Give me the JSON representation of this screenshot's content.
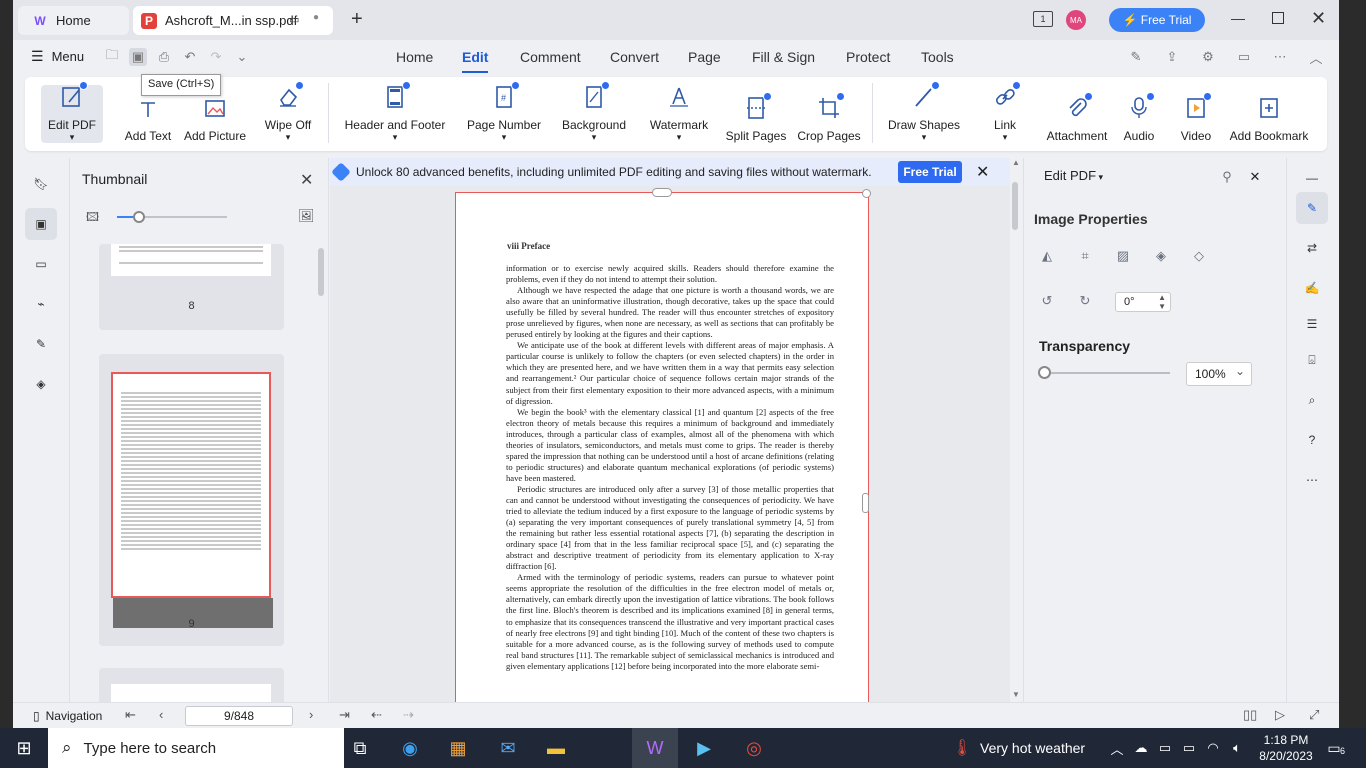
{
  "window": {
    "tabs": [
      {
        "label": "Home"
      },
      {
        "label": "Ashcroft_M...in ssp.pdf"
      }
    ],
    "free_trial": "Free Trial",
    "avatar_initials": "MA"
  },
  "menu": {
    "menu_label": "Menu",
    "tooltip": "Save (Ctrl+S)",
    "tabs": [
      "Home",
      "Edit",
      "Comment",
      "Convert",
      "Page",
      "Fill & Sign",
      "Protect",
      "Tools"
    ],
    "active_tab": "Edit"
  },
  "ribbon": {
    "tools": [
      {
        "label": "Edit PDF",
        "icon": "edit-pdf-icon"
      },
      {
        "label": "Add Text",
        "icon": "add-text-icon"
      },
      {
        "label": "Add Picture",
        "icon": "add-picture-icon"
      },
      {
        "label": "Wipe Off",
        "icon": "eraser-icon"
      },
      {
        "label": "Header and Footer",
        "icon": "header-footer-icon"
      },
      {
        "label": "Page Number",
        "icon": "page-number-icon"
      },
      {
        "label": "Background",
        "icon": "background-icon"
      },
      {
        "label": "Watermark",
        "icon": "watermark-icon"
      },
      {
        "label": "Split Pages",
        "icon": "split-pages-icon"
      },
      {
        "label": "Crop Pages",
        "icon": "crop-pages-icon"
      },
      {
        "label": "Draw Shapes",
        "icon": "draw-shapes-icon"
      },
      {
        "label": "Link",
        "icon": "link-icon"
      },
      {
        "label": "Attachment",
        "icon": "attachment-icon"
      },
      {
        "label": "Audio",
        "icon": "audio-icon"
      },
      {
        "label": "Video",
        "icon": "video-icon"
      },
      {
        "label": "Add Bookmark",
        "icon": "add-bookmark-icon"
      }
    ]
  },
  "thumbnail": {
    "title": "Thumbnail",
    "pages": [
      "8",
      "9"
    ]
  },
  "banner": {
    "text": "Unlock 80 advanced benefits, including unlimited PDF editing and saving files without watermark.",
    "button": "Free Trial"
  },
  "document": {
    "header": "viii   Preface",
    "paragraphs": [
      "information or to exercise newly acquired skills. Readers should therefore examine the problems, even if they do not intend to attempt their solution.",
      "Although we have respected the adage that one picture is worth a thousand words, we are also aware that an uninformative illustration, though decorative, takes up the space that could usefully be filled by several hundred. The reader will thus encounter stretches of expository prose unrelieved by figures, when none are necessary, as well as sections that can profitably be perused entirely by looking at the figures and their captions.",
      "We anticipate use of the book at different levels with different areas of major emphasis. A particular course is unlikely to follow the chapters (or even selected chapters) in the order in which they are presented here, and we have written them in a way that permits easy selection and rearrangement.² Our particular choice of sequence follows certain major strands of the subject from their first elementary exposition to their more advanced aspects, with a minimum of digression.",
      "We begin the book³ with the elementary classical [1] and quantum [2] aspects of the free electron theory of metals because this requires a minimum of background and immediately introduces, through a particular class of examples, almost all of the phenomena with which theories of insulators, semiconductors, and metals must come to grips. The reader is thereby spared the impression that nothing can be understood until a host of arcane definitions (relating to periodic structures) and elaborate quantum mechanical explorations (of periodic systems) have been mastered.",
      "Periodic structures are introduced only after a survey [3] of those metallic properties that can and cannot be understood without investigating the consequences of periodicity. We have tried to alleviate the tedium induced by a first exposure to the language of periodic systems by (a) separating the very important consequences of purely translational symmetry [4, 5] from the remaining but rather less essential rotational aspects [7], (b) separating the description in ordinary space [4] from that in the less familiar reciprocal space [5], and (c) separating the abstract and descriptive treatment of periodicity from its elementary application to X-ray diffraction [6].",
      "Armed with the terminology of periodic systems, readers can pursue to whatever point seems appropriate the resolution of the difficulties in the free electron model of metals or, alternatively, can embark directly upon the investigation of lattice vibrations. The book follows the first line. Bloch's theorem is described and its implications examined [8] in general terms, to emphasize that its consequences transcend the illustrative and very important practical cases of nearly free electrons [9] and tight binding [10]. Much of the content of these two chapters is suitable for a more advanced course, as is the following survey of methods used to compute real band structures [11]. The remarkable subject of semiclassical mechanics is introduced and given elementary applications [12] before being incorporated into the more elaborate semi-"
    ]
  },
  "right_panel": {
    "header": "Edit PDF",
    "title": "Image Properties",
    "rotation": "0°",
    "transparency_title": "Transparency",
    "transparency_value": "100%",
    "transparency_level": 0
  },
  "bottom": {
    "navigation": "Navigation",
    "page_indicator": "9/848"
  },
  "taskbar": {
    "search_placeholder": "Type here to search",
    "weather": "Very hot weather",
    "time": "1:18 PM",
    "date": "8/20/2023",
    "notification_count": "6"
  },
  "colors": {
    "accent": "#1e5bd6",
    "trial_button": "#3b82f6",
    "selection_border": "#e85a5a"
  }
}
